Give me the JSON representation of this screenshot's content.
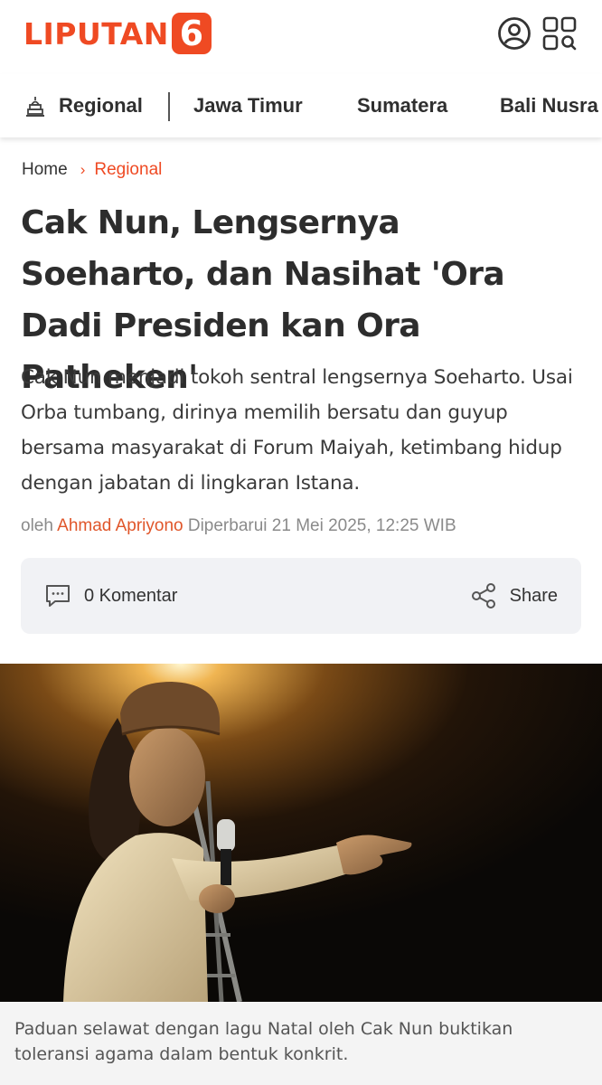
{
  "header": {
    "logo_text": "LIPUTAN",
    "logo_number": "6",
    "brand_color": "#ef4a23",
    "icons": [
      "user-icon",
      "grid-search-icon"
    ]
  },
  "nav": {
    "section_icon": "temple-icon",
    "items": [
      "Regional",
      "Jawa Timur",
      "Sumatera",
      "Bali Nusra"
    ]
  },
  "breadcrumb": {
    "home": "Home",
    "separator": "›",
    "current": "Regional"
  },
  "article": {
    "title": "Cak Nun, Lengsernya Soeharto, dan Nasihat 'Ora Dadi Presiden kan Ora Patheken'",
    "summary": "Cak Nun menjadi tokoh sentral lengsernya Soeharto. Usai Orba tumbang, dirinya memilih bersatu dan guyup bersama masyarakat di Forum Maiyah, ketimbang hidup dengan jabatan di lingkaran Istana.",
    "byline_prefix": "oleh",
    "author": "Ahmad Apriyono",
    "updated": "Diperbarui 21 Mei 2025, 12:25 WIB"
  },
  "actions": {
    "comments_label": "0 Komentar",
    "share_label": "Share"
  },
  "photo": {
    "caption": "Paduan selawat dengan lagu Natal oleh Cak Nun buktikan toleransi agama dalam bentuk konkrit."
  }
}
